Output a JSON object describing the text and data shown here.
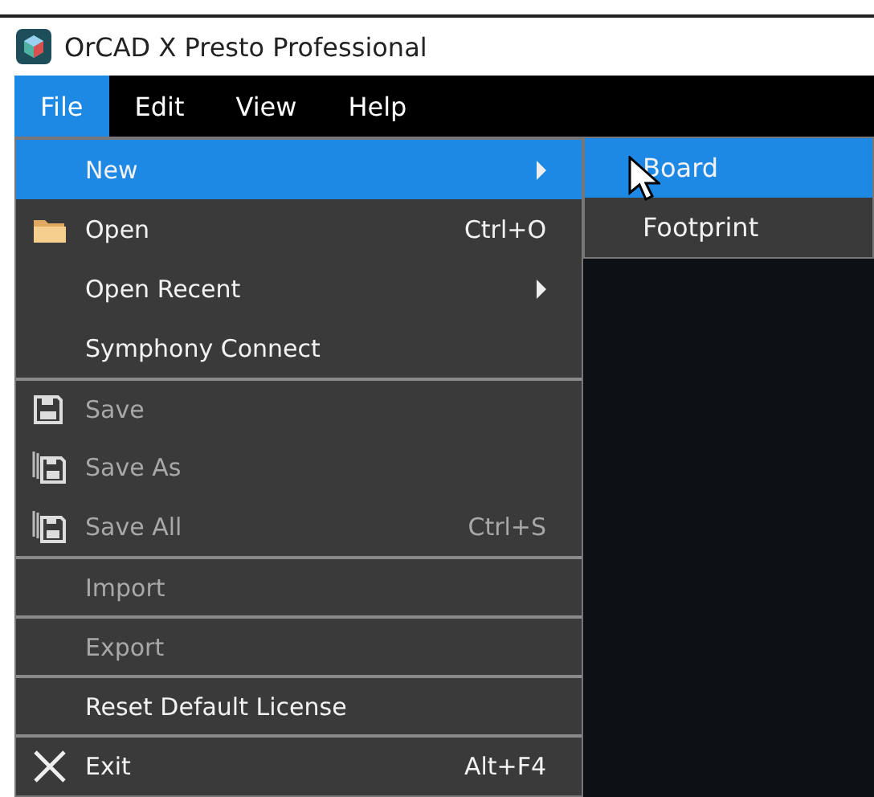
{
  "window": {
    "title": "OrCAD X Presto Professional"
  },
  "menubar": [
    {
      "label": "File",
      "selected": true
    },
    {
      "label": "Edit",
      "selected": false
    },
    {
      "label": "View",
      "selected": false
    },
    {
      "label": "Help",
      "selected": false
    }
  ],
  "file_menu": [
    {
      "label": "New",
      "selected": true,
      "disabled": false,
      "submenu": true,
      "separator_before": false
    },
    {
      "label": "Open",
      "kind": "folder",
      "shortcut": "Ctrl+O",
      "selected": false,
      "disabled": false,
      "submenu": false,
      "separator_before": false
    },
    {
      "label": "Open Recent",
      "selected": false,
      "disabled": false,
      "submenu": true,
      "separator_before": false
    },
    {
      "label": "Symphony Connect",
      "selected": false,
      "disabled": false,
      "submenu": false,
      "separator_before": false
    },
    {
      "label": "Save",
      "kind": "save",
      "selected": false,
      "disabled": true,
      "submenu": false,
      "separator_before": true
    },
    {
      "label": "Save As",
      "kind": "save-multiple",
      "selected": false,
      "disabled": true,
      "submenu": false,
      "separator_before": false
    },
    {
      "label": "Save All",
      "kind": "save-multiple",
      "shortcut": "Ctrl+S",
      "selected": false,
      "disabled": true,
      "submenu": false,
      "separator_before": false
    },
    {
      "label": "Import",
      "selected": false,
      "disabled": true,
      "submenu": false,
      "separator_before": true
    },
    {
      "label": "Export",
      "selected": false,
      "disabled": true,
      "submenu": false,
      "separator_before": true
    },
    {
      "label": "Reset Default License",
      "selected": false,
      "disabled": false,
      "submenu": false,
      "separator_before": true
    },
    {
      "label": "Exit",
      "kind": "close",
      "shortcut": "Alt+F4",
      "selected": false,
      "disabled": false,
      "submenu": false,
      "separator_before": true
    }
  ],
  "new_submenu": [
    {
      "label": "Board",
      "selected": true
    },
    {
      "label": "Footprint",
      "selected": false
    }
  ]
}
